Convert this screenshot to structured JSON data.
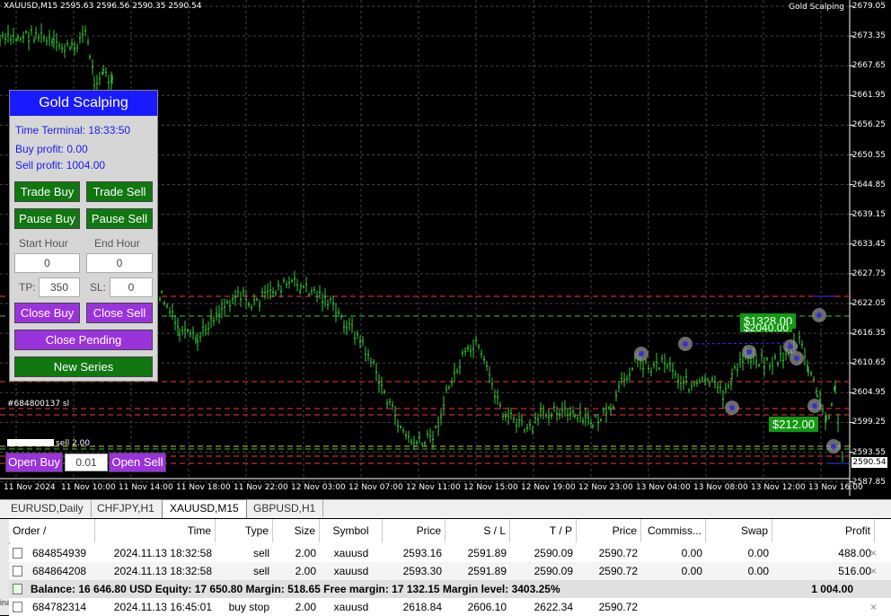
{
  "chart": {
    "symbol_title": "XAUUSD,M15  2595.63 2596.56 2590.35 2590.54",
    "ea_label": "Gold Scalping",
    "current_price": "2590.54",
    "price_scale": [
      "2679.05",
      "2673.35",
      "2667.65",
      "2661.95",
      "2656.25",
      "2650.55",
      "2644.85",
      "2639.15",
      "2633.45",
      "2627.75",
      "2622.05",
      "2616.35",
      "2610.65",
      "2604.95",
      "2599.25",
      "2593.55",
      "2587.85"
    ],
    "time_axis": [
      "11 Nov 2024",
      "11 Nov 10:00",
      "11 Nov 14:00",
      "11 Nov 18:00",
      "11 Nov 22:00",
      "12 Nov 03:00",
      "12 Nov 07:00",
      "12 Nov 11:00",
      "12 Nov 15:00",
      "12 Nov 19:00",
      "12 Nov 23:00",
      "13 Nov 04:00",
      "13 Nov 08:00",
      "13 Nov 12:00",
      "13 Nov 16:00"
    ],
    "order_tag_1": "#684800137 sl",
    "order_tag_2": "sell 2.00",
    "profit_badge_1": "$1328.00",
    "profit_badge_1_under": "$2040.00",
    "profit_badge_2": "$212.00",
    "lot_value": "0.01",
    "open_buy_label": "Open Buy",
    "open_sell_label": "Open Sell",
    "colors": {
      "candle": "#33cc33",
      "grid": "#444444",
      "red_line": "#ff3333",
      "green_line": "#33cc33",
      "yellow_line": "#cccc33"
    }
  },
  "panel": {
    "title": "Gold Scalping",
    "time_terminal": "Time Terminal: 18:33:50",
    "buy_profit": "Buy profit: 0.00",
    "sell_profit": "Sell profit: 1004.00",
    "trade_buy": "Trade Buy",
    "trade_sell": "Trade Sell",
    "pause_buy": "Pause Buy",
    "pause_sell": "Pause Sell",
    "start_hour_label": "Start Hour",
    "end_hour_label": "End Hour",
    "start_hour_value": "0",
    "end_hour_value": "0",
    "tp_label": "TP:",
    "tp_value": "350",
    "sl_label": "SL:",
    "sl_value": "0",
    "close_buy": "Close Buy",
    "close_sell": "Close Sell",
    "close_pending": "Close Pending",
    "new_series": "New Series"
  },
  "tabs": [
    "EURUSD,Daily",
    "CHFJPY,H1",
    "XAUUSD,M15",
    "GBPUSD,H1"
  ],
  "terminal": {
    "side_label": "inal",
    "headers": [
      "Order",
      "/",
      "Time",
      "Type",
      "Size",
      "Symbol",
      "Price",
      "S / L",
      "T / P",
      "Price",
      "Commiss...",
      "Swap",
      "Profit"
    ],
    "rows": [
      {
        "order": "684854939",
        "time": "2024.11.13 18:32:58",
        "type": "sell",
        "size": "2.00",
        "symbol": "xauusd",
        "price": "2593.16",
        "sl": "2591.89",
        "tp": "2590.09",
        "cur": "2590.72",
        "comm": "0.00",
        "swap": "0.00",
        "profit": "488.00"
      },
      {
        "order": "684864208",
        "time": "2024.11.13 18:32:58",
        "type": "sell",
        "size": "2.00",
        "symbol": "xauusd",
        "price": "2593.30",
        "sl": "2591.89",
        "tp": "2590.09",
        "cur": "2590.72",
        "comm": "0.00",
        "swap": "0.00",
        "profit": "516.00"
      }
    ],
    "balance_line": "Balance: 16 646.80 USD  Equity: 17 650.80  Margin: 518.65  Free margin: 17 132.15  Margin level: 3403.25%",
    "balance_total": "1 004.00",
    "pending_row": {
      "order": "684782314",
      "time": "2024.11.13 16:45:01",
      "type": "buy stop",
      "size": "2.00",
      "symbol": "xauusd",
      "price": "2618.84",
      "sl": "2606.10",
      "tp": "2622.34",
      "cur": "2590.72"
    },
    "close_symbol": "×"
  }
}
